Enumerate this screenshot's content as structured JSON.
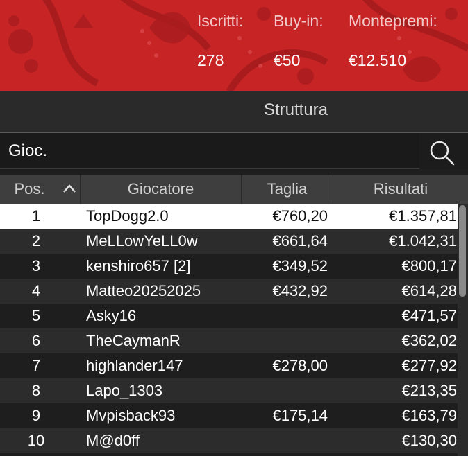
{
  "header": {
    "stats": [
      {
        "label": "Iscritti:",
        "value": "278"
      },
      {
        "label": "Buy-in:",
        "value": "€50"
      },
      {
        "label": "Montepremi:",
        "value": "€12.510"
      }
    ]
  },
  "structure": {
    "title": "Struttura"
  },
  "search": {
    "label": "Gioc."
  },
  "table": {
    "columns": [
      "Pos.",
      "Giocatore",
      "Taglia",
      "Risultati"
    ],
    "rows": [
      {
        "pos": "1",
        "name": "TopDogg2.0",
        "taglia": "€760,20",
        "risultati": "€1.357,81"
      },
      {
        "pos": "2",
        "name": "MeLLowYeLL0w",
        "taglia": "€661,64",
        "risultati": "€1.042,31"
      },
      {
        "pos": "3",
        "name": "kenshiro657 [2]",
        "taglia": "€349,52",
        "risultati": "€800,17"
      },
      {
        "pos": "4",
        "name": "Matteo20252025",
        "taglia": "€432,92",
        "risultati": "€614,28"
      },
      {
        "pos": "5",
        "name": "Asky16",
        "taglia": "",
        "risultati": "€471,57"
      },
      {
        "pos": "6",
        "name": "TheCaymanR",
        "taglia": "",
        "risultati": "€362,02"
      },
      {
        "pos": "7",
        "name": "highlander147",
        "taglia": "€278,00",
        "risultati": "€277,92"
      },
      {
        "pos": "8",
        "name": "Lapo_1303",
        "taglia": "",
        "risultati": "€213,35"
      },
      {
        "pos": "9",
        "name": "Mvpisback93",
        "taglia": "€175,14",
        "risultati": "€163,79"
      },
      {
        "pos": "10",
        "name": "M@d0ff",
        "taglia": "",
        "risultati": "€130,30"
      }
    ]
  },
  "colors": {
    "banner": "#c72426",
    "background": "#1e1e1e",
    "header_row": "#3e3e3e",
    "alt_row": "#2c2c2c",
    "selected_row": "#ffffff"
  }
}
